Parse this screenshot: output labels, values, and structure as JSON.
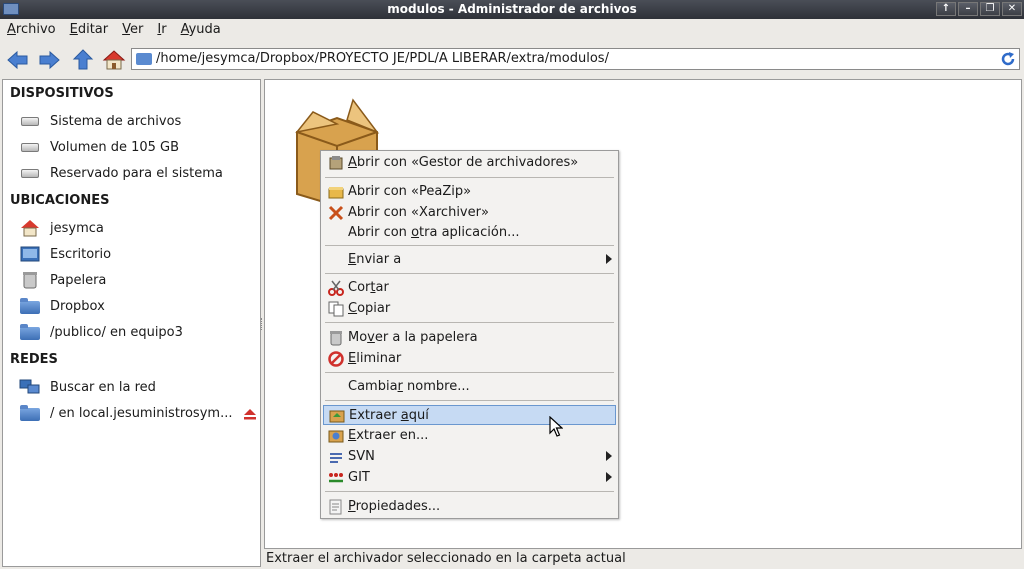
{
  "window": {
    "title": "modulos - Administrador de archivos",
    "buttons": [
      "↑",
      "–",
      "❐",
      "✕"
    ]
  },
  "menubar": [
    "Archivo",
    "Editar",
    "Ver",
    "Ir",
    "Ayuda"
  ],
  "location": {
    "path": "/home/jesymca/Dropbox/PROYECTO JE/PDL/A LIBERAR/extra/modulos/"
  },
  "sidebar": {
    "sections": [
      "DISPOSITIVOS",
      "UBICACIONES",
      "REDES"
    ],
    "devices": [
      "Sistema de archivos",
      "Volumen de 105 GB",
      "Reservado para el sistema"
    ],
    "places": [
      "jesymca",
      "Escritorio",
      "Papelera",
      "Dropbox",
      "/publico/ en equipo3"
    ],
    "network": [
      "Buscar en la red",
      "/ en local.jesuministrosym..."
    ]
  },
  "context_menu": {
    "items": [
      {
        "pre": "",
        "u": "A",
        "post": "brir con «Gestor de archivadores»"
      },
      {
        "pre": "Abrir con «PeaZip»",
        "u": "",
        "post": ""
      },
      {
        "pre": "Abrir con «Xarchiver»",
        "u": "",
        "post": ""
      },
      {
        "pre": "Abrir con ",
        "u": "o",
        "post": "tra aplicación..."
      },
      {
        "pre": "",
        "u": "E",
        "post": "nviar a"
      },
      {
        "pre": "Cor",
        "u": "t",
        "post": "ar"
      },
      {
        "pre": "",
        "u": "C",
        "post": "opiar"
      },
      {
        "pre": "Mo",
        "u": "v",
        "post": "er a la papelera"
      },
      {
        "pre": "",
        "u": "E",
        "post": "liminar"
      },
      {
        "pre": "Cambia",
        "u": "r",
        "post": " nombre..."
      },
      {
        "pre": "Extraer ",
        "u": "a",
        "post": "quí"
      },
      {
        "pre": "",
        "u": "E",
        "post": "xtraer en..."
      },
      {
        "pre": "SVN",
        "u": "",
        "post": ""
      },
      {
        "pre": "GIT",
        "u": "",
        "post": ""
      },
      {
        "pre": "",
        "u": "P",
        "post": "ropiedades..."
      }
    ]
  },
  "statusbar": {
    "text": "Extraer el archivador seleccionado en la carpeta actual"
  },
  "colors": {
    "highlight": "#c6daf3",
    "title_bar": "#3a3d44",
    "folder": "#4f80c8"
  }
}
